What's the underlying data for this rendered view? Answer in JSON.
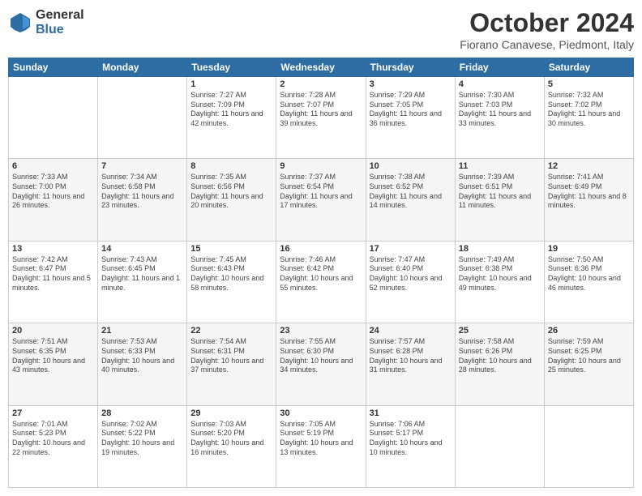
{
  "logo": {
    "general": "General",
    "blue": "Blue"
  },
  "title": "October 2024",
  "location": "Fiorano Canavese, Piedmont, Italy",
  "days": [
    "Sunday",
    "Monday",
    "Tuesday",
    "Wednesday",
    "Thursday",
    "Friday",
    "Saturday"
  ],
  "weeks": [
    [
      {
        "day": "",
        "info": ""
      },
      {
        "day": "",
        "info": ""
      },
      {
        "day": "1",
        "info": "Sunrise: 7:27 AM\nSunset: 7:09 PM\nDaylight: 11 hours and 42 minutes."
      },
      {
        "day": "2",
        "info": "Sunrise: 7:28 AM\nSunset: 7:07 PM\nDaylight: 11 hours and 39 minutes."
      },
      {
        "day": "3",
        "info": "Sunrise: 7:29 AM\nSunset: 7:05 PM\nDaylight: 11 hours and 36 minutes."
      },
      {
        "day": "4",
        "info": "Sunrise: 7:30 AM\nSunset: 7:03 PM\nDaylight: 11 hours and 33 minutes."
      },
      {
        "day": "5",
        "info": "Sunrise: 7:32 AM\nSunset: 7:02 PM\nDaylight: 11 hours and 30 minutes."
      }
    ],
    [
      {
        "day": "6",
        "info": "Sunrise: 7:33 AM\nSunset: 7:00 PM\nDaylight: 11 hours and 26 minutes."
      },
      {
        "day": "7",
        "info": "Sunrise: 7:34 AM\nSunset: 6:58 PM\nDaylight: 11 hours and 23 minutes."
      },
      {
        "day": "8",
        "info": "Sunrise: 7:35 AM\nSunset: 6:56 PM\nDaylight: 11 hours and 20 minutes."
      },
      {
        "day": "9",
        "info": "Sunrise: 7:37 AM\nSunset: 6:54 PM\nDaylight: 11 hours and 17 minutes."
      },
      {
        "day": "10",
        "info": "Sunrise: 7:38 AM\nSunset: 6:52 PM\nDaylight: 11 hours and 14 minutes."
      },
      {
        "day": "11",
        "info": "Sunrise: 7:39 AM\nSunset: 6:51 PM\nDaylight: 11 hours and 11 minutes."
      },
      {
        "day": "12",
        "info": "Sunrise: 7:41 AM\nSunset: 6:49 PM\nDaylight: 11 hours and 8 minutes."
      }
    ],
    [
      {
        "day": "13",
        "info": "Sunrise: 7:42 AM\nSunset: 6:47 PM\nDaylight: 11 hours and 5 minutes."
      },
      {
        "day": "14",
        "info": "Sunrise: 7:43 AM\nSunset: 6:45 PM\nDaylight: 11 hours and 1 minute."
      },
      {
        "day": "15",
        "info": "Sunrise: 7:45 AM\nSunset: 6:43 PM\nDaylight: 10 hours and 58 minutes."
      },
      {
        "day": "16",
        "info": "Sunrise: 7:46 AM\nSunset: 6:42 PM\nDaylight: 10 hours and 55 minutes."
      },
      {
        "day": "17",
        "info": "Sunrise: 7:47 AM\nSunset: 6:40 PM\nDaylight: 10 hours and 52 minutes."
      },
      {
        "day": "18",
        "info": "Sunrise: 7:49 AM\nSunset: 6:38 PM\nDaylight: 10 hours and 49 minutes."
      },
      {
        "day": "19",
        "info": "Sunrise: 7:50 AM\nSunset: 6:36 PM\nDaylight: 10 hours and 46 minutes."
      }
    ],
    [
      {
        "day": "20",
        "info": "Sunrise: 7:51 AM\nSunset: 6:35 PM\nDaylight: 10 hours and 43 minutes."
      },
      {
        "day": "21",
        "info": "Sunrise: 7:53 AM\nSunset: 6:33 PM\nDaylight: 10 hours and 40 minutes."
      },
      {
        "day": "22",
        "info": "Sunrise: 7:54 AM\nSunset: 6:31 PM\nDaylight: 10 hours and 37 minutes."
      },
      {
        "day": "23",
        "info": "Sunrise: 7:55 AM\nSunset: 6:30 PM\nDaylight: 10 hours and 34 minutes."
      },
      {
        "day": "24",
        "info": "Sunrise: 7:57 AM\nSunset: 6:28 PM\nDaylight: 10 hours and 31 minutes."
      },
      {
        "day": "25",
        "info": "Sunrise: 7:58 AM\nSunset: 6:26 PM\nDaylight: 10 hours and 28 minutes."
      },
      {
        "day": "26",
        "info": "Sunrise: 7:59 AM\nSunset: 6:25 PM\nDaylight: 10 hours and 25 minutes."
      }
    ],
    [
      {
        "day": "27",
        "info": "Sunrise: 7:01 AM\nSunset: 5:23 PM\nDaylight: 10 hours and 22 minutes."
      },
      {
        "day": "28",
        "info": "Sunrise: 7:02 AM\nSunset: 5:22 PM\nDaylight: 10 hours and 19 minutes."
      },
      {
        "day": "29",
        "info": "Sunrise: 7:03 AM\nSunset: 5:20 PM\nDaylight: 10 hours and 16 minutes."
      },
      {
        "day": "30",
        "info": "Sunrise: 7:05 AM\nSunset: 5:19 PM\nDaylight: 10 hours and 13 minutes."
      },
      {
        "day": "31",
        "info": "Sunrise: 7:06 AM\nSunset: 5:17 PM\nDaylight: 10 hours and 10 minutes."
      },
      {
        "day": "",
        "info": ""
      },
      {
        "day": "",
        "info": ""
      }
    ]
  ]
}
